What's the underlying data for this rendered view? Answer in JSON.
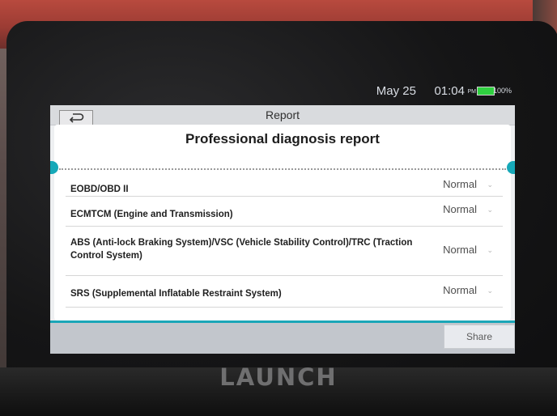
{
  "status": {
    "date": "May 25",
    "time": "01:04",
    "ampm": "PM",
    "battery": "100%",
    "battery_color": "#2fd040"
  },
  "header": {
    "back_icon": "back-arrow-icon",
    "title": "Report"
  },
  "report": {
    "heading": "Professional diagnosis report",
    "rows": [
      {
        "label": "EOBD/OBD II",
        "status": "Normal"
      },
      {
        "label": "ECMTCM (Engine and Transmission)",
        "status": "Normal"
      },
      {
        "label": "ABS (Anti-lock Braking System)/VSC (Vehicle Stability Control)/TRC (Traction Control System)",
        "status": "Normal"
      },
      {
        "label": "SRS (Supplemental Inflatable Restraint System)",
        "status": "Normal"
      }
    ]
  },
  "footer": {
    "share_label": "Share"
  },
  "device": {
    "brand": "LAUNCH",
    "accent_color": "#16a8b8"
  }
}
